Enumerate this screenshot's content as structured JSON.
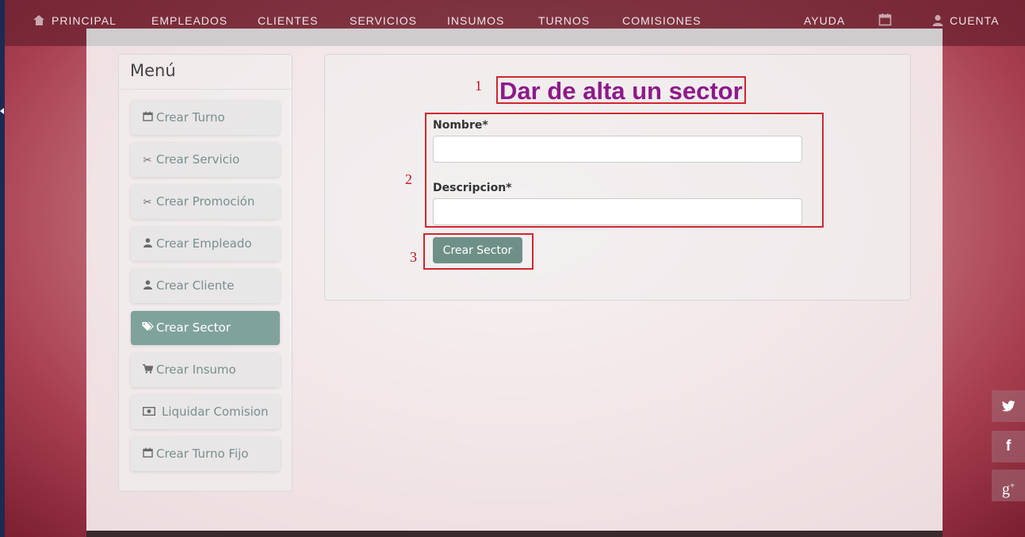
{
  "nav": {
    "principal": "PRINCIPAL",
    "empleados": "EMPLEADOS",
    "clientes": "CLIENTES",
    "servicios": "SERVICIOS",
    "insumos": "INSUMOS",
    "turnos": "TURNOS",
    "comisiones": "COMISIONES",
    "ayuda": "AYUDA",
    "cuenta": "CUENTA"
  },
  "menu": {
    "title": "Menú",
    "items": [
      {
        "label": "Crear Turno",
        "icon": "calendar-icon"
      },
      {
        "label": "Crear Servicio",
        "icon": "scissors-icon"
      },
      {
        "label": "Crear Promoción",
        "icon": "scissors-icon"
      },
      {
        "label": "Crear Empleado",
        "icon": "user-icon"
      },
      {
        "label": "Crear Cliente",
        "icon": "user-icon"
      },
      {
        "label": "Crear Sector",
        "icon": "tags-icon",
        "active": true
      },
      {
        "label": "Crear Insumo",
        "icon": "cart-icon"
      },
      {
        "label": "Liquidar Comision",
        "icon": "money-icon"
      },
      {
        "label": "Crear Turno Fijo",
        "icon": "calendar-icon"
      }
    ]
  },
  "form": {
    "heading": "Dar de alta un sector",
    "nombre_label": "Nombre*",
    "nombre_value": "",
    "descripcion_label": "Descripcion*",
    "descripcion_value": "",
    "submit_label": "Crear Sector"
  },
  "annotations": {
    "one": "1",
    "two": "2",
    "three": "3"
  },
  "social": {
    "twitter": "twitter-icon",
    "facebook": "facebook-icon",
    "googleplus": "google-plus-icon"
  },
  "colors": {
    "accent": "#6e9088",
    "active_menu": "#7fa39c",
    "heading": "#8e1a8a",
    "annotation": "#d1262e"
  }
}
